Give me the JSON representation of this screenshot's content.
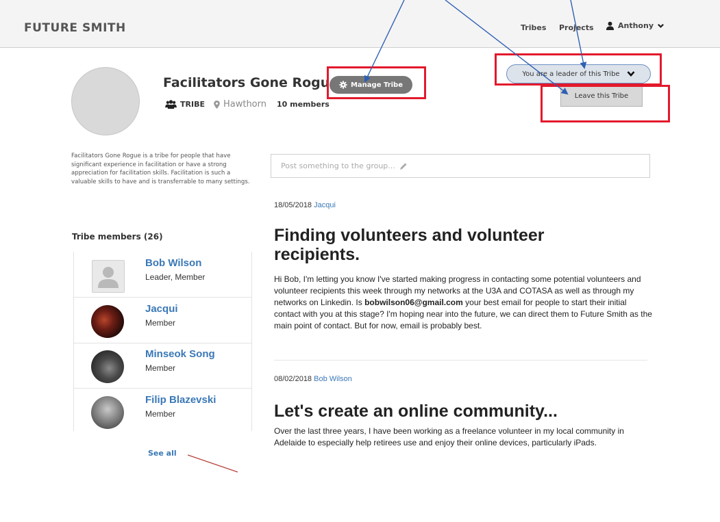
{
  "nav": {
    "brand": "FUTURE SMITH",
    "links": [
      "Tribes",
      "Projects"
    ],
    "user": "Anthony"
  },
  "tribe": {
    "name": "Facilitators Gone Rogue",
    "manage_label": "Manage Tribe",
    "type_label": "TRIBE",
    "location": "Hawthorn",
    "members_count": "10 members",
    "leader_status": "You are a leader of this Tribe",
    "leave_label": "Leave this Tribe",
    "description": "Facilitators Gone Rogue is a tribe for people that have significant experience in facilitation or have a strong appreciation for facilitation skills. Facilitation is such a valuable skills to have and is transferrable to many settings."
  },
  "members": {
    "title": "Tribe members (26)",
    "list": [
      {
        "name": "Bob Wilson",
        "role": "Leader, Member"
      },
      {
        "name": "Jacqui",
        "role": "Member"
      },
      {
        "name": "Minseok Song",
        "role": "Member"
      },
      {
        "name": "Filip Blazevski",
        "role": "Member"
      }
    ],
    "see_all": "See all"
  },
  "composer": {
    "placeholder": "Post something to the group..."
  },
  "posts": [
    {
      "date": "18/05/2018",
      "author": "Jacqui",
      "title": "Finding volunteers and volunteer recipients.",
      "body_before": "Hi Bob, I'm letting you know I've started making progress in contacting some potential volunteers and volunteer recipients this week through my networks at the U3A and COTASA as well as through my networks on Linkedin. Is ",
      "body_bold": "bobwilson06@gmail.com",
      "body_after": " your best email for people to start their initial contact with you at this stage? I'm hoping near into the future, we can direct them to Future Smith as the main point of contact. But for now, email is probably best."
    },
    {
      "date": "08/02/2018",
      "author": "Bob Wilson",
      "title": "Let's create an online community...",
      "body": "Over the last three years, I have been working as a freelance volunteer in my local community in Adelaide to especially help retirees use and enjoy their online devices, particularly iPads."
    }
  ],
  "colors": {
    "link": "#3a78b6",
    "annotation_box": "#e3192c",
    "annotation_arrow": "#2f5fb3"
  }
}
